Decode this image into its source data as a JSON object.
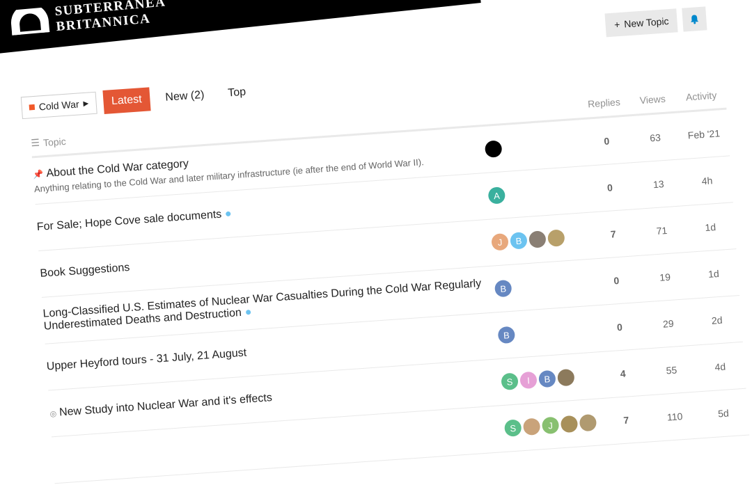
{
  "header": {
    "logo_line1": "SUBTERRANEA",
    "logo_line2": "BRITANNICA",
    "new_topic_label": "New Topic",
    "new_topic_icon": "plus-icon",
    "notifications_icon": "bell-icon"
  },
  "nav": {
    "category": "Cold War",
    "category_color": "#f1592a",
    "tabs": [
      "Latest",
      "New (2)",
      "Top"
    ],
    "active_tab": "Latest",
    "accent_color": "#e45735"
  },
  "columns": {
    "topic": "Topic",
    "replies": "Replies",
    "views": "Views",
    "activity": "Activity"
  },
  "topics": [
    {
      "title": "About the Cold War category",
      "excerpt": "Anything relating to the Cold War and later military infrastructure (ie after the end of World War II).",
      "pinned": true,
      "replies": "0",
      "views": "63",
      "activity": "Feb '21",
      "users": [
        {
          "letter": "",
          "color": "#000000"
        }
      ]
    },
    {
      "title": "For Sale; Hope Cove sale documents",
      "unread": true,
      "replies": "0",
      "views": "13",
      "activity": "4h",
      "users": [
        {
          "letter": "A",
          "color": "#3ab09e"
        }
      ]
    },
    {
      "title": "Book Suggestions",
      "replies": "7",
      "views": "71",
      "activity": "1d",
      "users": [
        {
          "letter": "J",
          "color": "#e8a87c"
        },
        {
          "letter": "B",
          "color": "#6cc3f0"
        },
        {
          "letter": "",
          "color": "#8a7f74"
        },
        {
          "letter": "",
          "color": "#b8a06a"
        }
      ]
    },
    {
      "title": "Long-Classified U.S. Estimates of Nuclear War Casualties During the Cold War Regularly Underestimated Deaths and Destruction",
      "unread": true,
      "replies": "0",
      "views": "19",
      "activity": "1d",
      "users": [
        {
          "letter": "B",
          "color": "#6688c2"
        }
      ]
    },
    {
      "title": "Upper Heyford tours - 31 July, 21 August",
      "replies": "0",
      "views": "29",
      "activity": "2d",
      "users": [
        {
          "letter": "B",
          "color": "#6688c2"
        }
      ]
    },
    {
      "title": "New Study into Nuclear War and it's effects",
      "unlisted": true,
      "replies": "4",
      "views": "55",
      "activity": "4d",
      "users": [
        {
          "letter": "S",
          "color": "#5bbf8a"
        },
        {
          "letter": "I",
          "color": "#e6a0d6"
        },
        {
          "letter": "B",
          "color": "#6688c2"
        },
        {
          "letter": "",
          "color": "#8c7a5c"
        }
      ]
    },
    {
      "title": "",
      "replies": "7",
      "views": "110",
      "activity": "5d",
      "users": [
        {
          "letter": "S",
          "color": "#5bbf8a"
        },
        {
          "letter": "",
          "color": "#c9a37a"
        },
        {
          "letter": "J",
          "color": "#88c070"
        },
        {
          "letter": "",
          "color": "#a8905a"
        },
        {
          "letter": "",
          "color": "#b09a70"
        }
      ]
    }
  ]
}
